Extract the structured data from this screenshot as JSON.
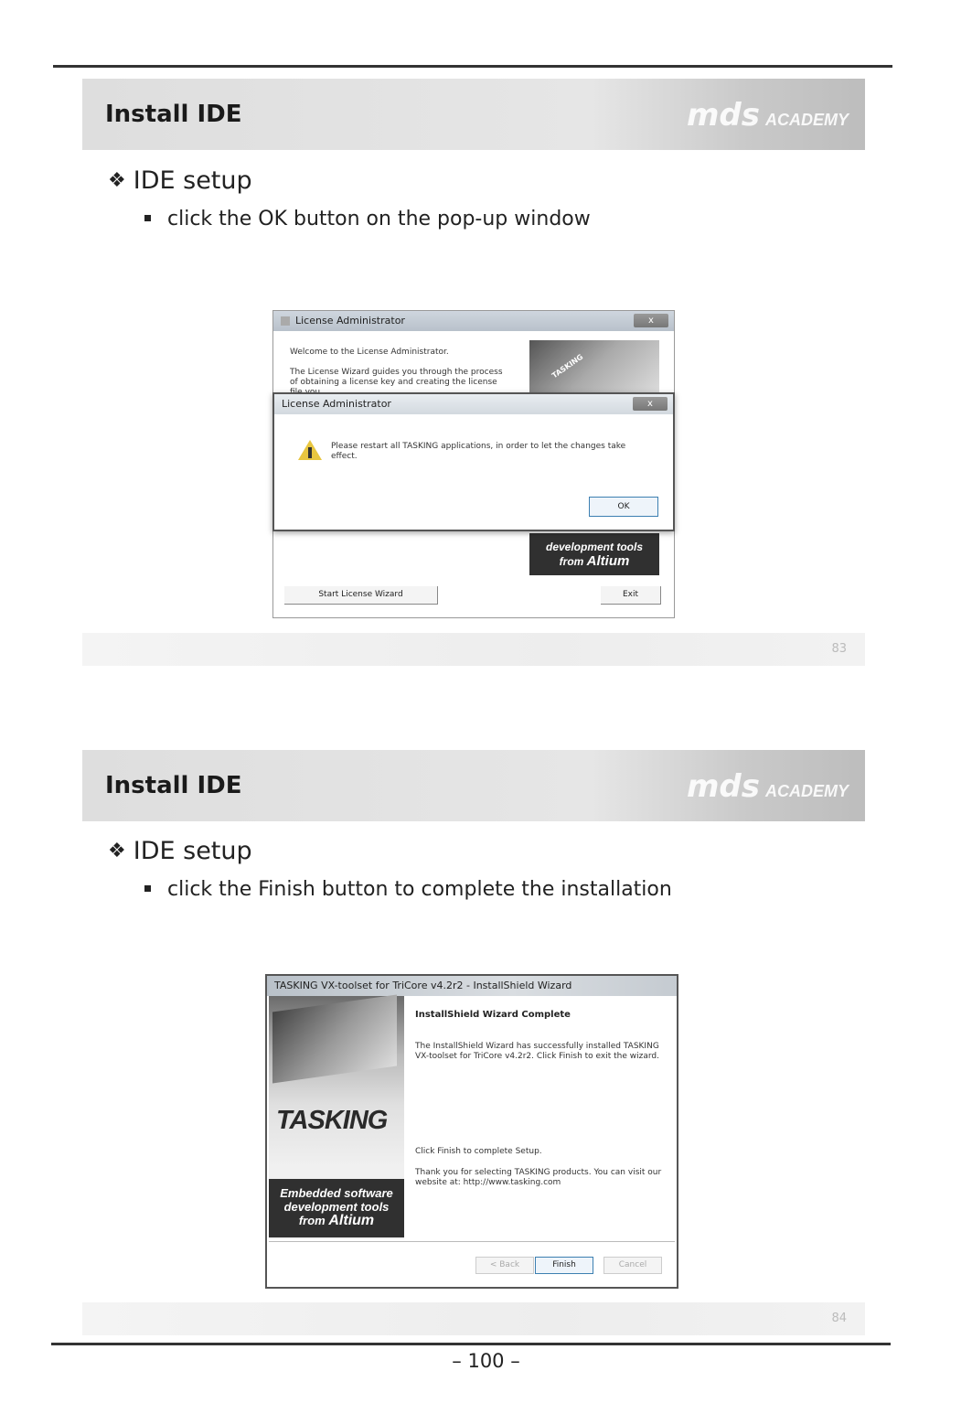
{
  "logo": {
    "mark": "mds",
    "word": "ACADEMY"
  },
  "slides": [
    {
      "title": "Install IDE",
      "heading": "IDE setup",
      "bullet": "click the OK button on the pop-up window",
      "number": "83",
      "bg_window": {
        "title": "License Administrator",
        "welcome": "Welcome to the License Administrator.",
        "body": "The License Wizard guides you through the process of obtaining a license key and creating the license file you",
        "brand_line1": "development tools",
        "brand_line2": "from",
        "brand_name": "Altium",
        "start_button": "Start License Wizard",
        "exit_button": "Exit",
        "chip_label": "TASKING"
      },
      "dialog": {
        "title": "License Administrator",
        "close": "x",
        "message": "Please restart all TASKING applications, in order to let the changes take effect.",
        "ok_button": "OK"
      }
    },
    {
      "title": "Install IDE",
      "heading": "IDE setup",
      "bullet": "click the Finish button to complete the installation",
      "number": "84",
      "wizard": {
        "title": "TASKING VX-toolset for TriCore v4.2r2 - InstallShield Wizard",
        "heading": "InstallShield Wizard Complete",
        "text1": "The InstallShield Wizard has successfully installed TASKING VX-toolset for TriCore v4.2r2. Click Finish to exit the wizard.",
        "text2": "Click Finish to complete Setup.",
        "text3": "Thank you for selecting TASKING products. You can visit our website at: http://www.tasking.com",
        "brand": "TASKING",
        "brand_line1": "Embedded software",
        "brand_line2": "development tools",
        "brand_line3": "from",
        "brand_name": "Altium",
        "back_button": "< Back",
        "finish_button": "Finish",
        "cancel_button": "Cancel"
      }
    }
  ],
  "page_number": "– 100 –"
}
